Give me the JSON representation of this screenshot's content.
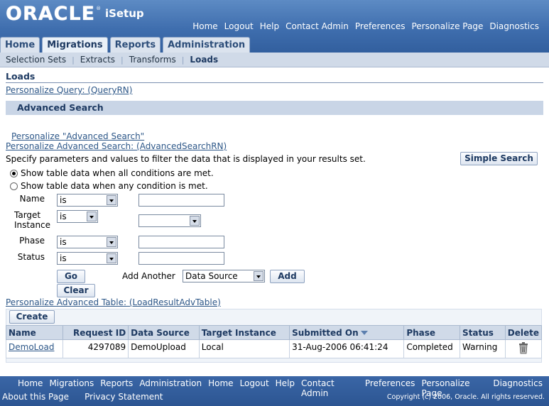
{
  "header": {
    "brand": "ORACLE",
    "app_name": "iSetup",
    "global_nav": [
      "Home",
      "Logout",
      "Help",
      "Contact Admin",
      "Preferences",
      "Personalize Page",
      "Diagnostics"
    ]
  },
  "tabs": [
    "Home",
    "Migrations",
    "Reports",
    "Administration"
  ],
  "active_tab": "Migrations",
  "subtabs": [
    "Selection Sets",
    "Extracts",
    "Transforms",
    "Loads"
  ],
  "active_subtab": "Loads",
  "page": {
    "title": "Loads",
    "personalize_query": "Personalize Query: (QueryRN)"
  },
  "advanced_search": {
    "header": "Advanced Search",
    "personalize_link": "Personalize \"Advanced Search\"",
    "personalize_region": "Personalize Advanced Search: (AdvancedSearchRN)",
    "instruction": "Specify parameters and values to filter the data that is displayed in your results set.",
    "simple_search_label": "Simple Search",
    "radio_all": "Show table data when all conditions are met.",
    "radio_any": "Show table data when any condition is met.",
    "fields": {
      "name": {
        "label": "Name",
        "operator": "is",
        "value": ""
      },
      "target_instance": {
        "label_line1": "Target",
        "label_line2": "Instance",
        "operator": "is",
        "value": ""
      },
      "phase": {
        "label": "Phase",
        "operator": "is",
        "value": ""
      },
      "status": {
        "label": "Status",
        "operator": "is",
        "value": ""
      }
    },
    "go_label": "Go",
    "clear_label": "Clear",
    "add_another_label": "Add Another",
    "add_another_value": "Data Source",
    "add_label": "Add"
  },
  "results": {
    "personalize_table": "Personalize Advanced Table: (LoadResultAdvTable)",
    "create_label": "Create",
    "columns": [
      "Name",
      "Request ID",
      "Data Source",
      "Target Instance",
      "Submitted On",
      "Phase",
      "Status",
      "Delete"
    ],
    "rows": [
      {
        "name": "DemoLoad",
        "request_id": "4297089",
        "data_source": "DemoUpload",
        "target_instance": "Local",
        "submitted_on": "31-Aug-2006 06:41:24",
        "phase": "Completed",
        "status": "Warning"
      }
    ]
  },
  "footer": {
    "nav": [
      "Home",
      "Migrations",
      "Reports",
      "Administration",
      "Home",
      "Logout",
      "Help",
      "Contact Admin",
      "Preferences",
      "Personalize Page",
      "Diagnostics"
    ],
    "about": "About this Page",
    "privacy": "Privacy Statement",
    "copyright": "Copyright (c) 2006, Oracle. All rights reserved."
  },
  "icons": {
    "delete": "trash-icon",
    "sort": "sort-descending-icon"
  },
  "colors": {
    "header_blue": "#3f6eae",
    "tab_bg": "#dbe3ee",
    "link": "#2d5788"
  }
}
